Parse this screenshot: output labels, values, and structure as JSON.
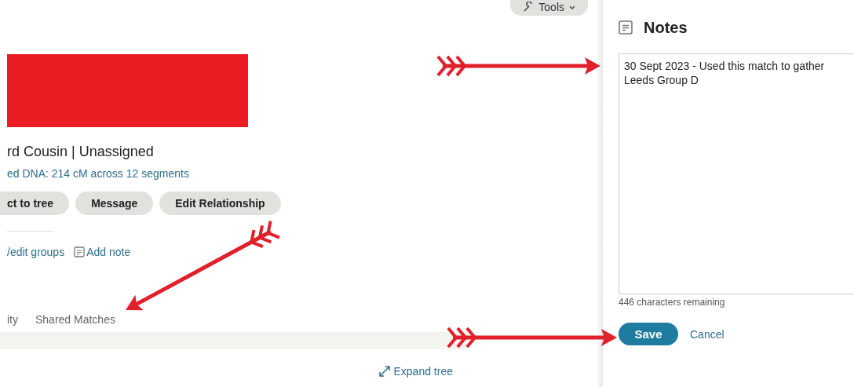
{
  "toolbar": {
    "tools_button": "Tools"
  },
  "match": {
    "relationship": "rd Cousin | Unassigned",
    "shared_dna": "ed DNA: 214 cM across 12 segments",
    "actions": [
      "ct to tree",
      "Message",
      "Edit Relationship"
    ],
    "links": [
      {
        "kind": "plain",
        "label": "/edit groups"
      },
      {
        "kind": "note",
        "label": "Add note"
      }
    ]
  },
  "tabs": [
    {
      "label": "ity"
    },
    {
      "label": "Shared Matches"
    }
  ],
  "tree": {
    "expand_link": "Expand tree"
  },
  "notes": {
    "title": "Notes",
    "value": "30 Sept 2023 - Used this match to gather Leeds Group D",
    "remaining": "446 characters remaining",
    "buttons": [
      {
        "kind": "primary",
        "label": "Save"
      },
      {
        "kind": "link",
        "label": "Cancel"
      }
    ]
  }
}
